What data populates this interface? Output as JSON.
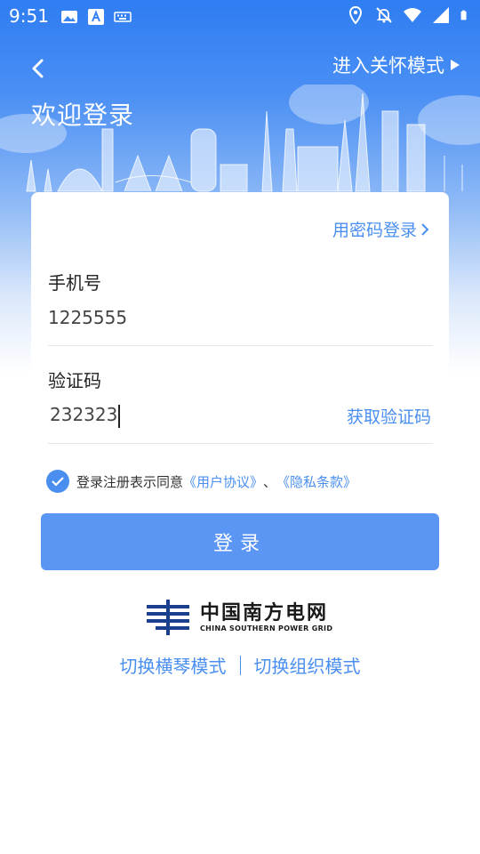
{
  "status_bar": {
    "time": "9:51"
  },
  "header": {
    "care_mode_label": "进入关怀模式",
    "welcome_title": "欢迎登录"
  },
  "form": {
    "password_login_link": "用密码登录",
    "phone_label": "手机号",
    "phone_value": "1225555",
    "code_label": "验证码",
    "code_value": "232323",
    "get_code_button": "获取验证码"
  },
  "agreement": {
    "prefix": "登录注册表示同意",
    "user_agreement": "《用户协议》",
    "separator": "、",
    "privacy_policy": "《隐私条款》"
  },
  "login_button": "登录",
  "logo": {
    "name_cn": "中国南方电网",
    "name_en": "CHINA SOUTHERN POWER GRID"
  },
  "switch": {
    "piano_mode": "切换横琴模式",
    "org_mode": "切换组织模式"
  },
  "colors": {
    "accent": "#4a8ff0",
    "button": "#5b96f5",
    "header_top": "#2f7df2"
  }
}
